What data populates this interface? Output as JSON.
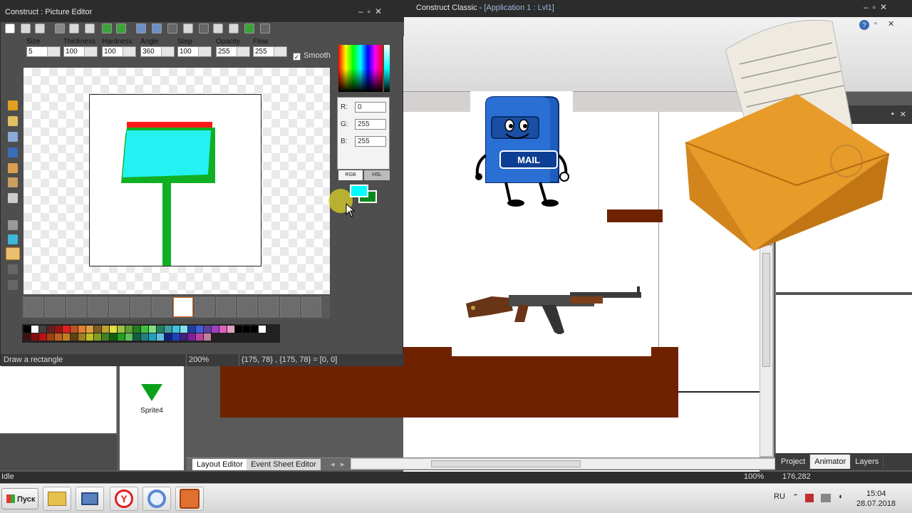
{
  "picture_editor": {
    "title": "Construct : Picture Editor",
    "params": [
      {
        "label": "Size",
        "value": "5"
      },
      {
        "label": "Thickness",
        "value": "100"
      },
      {
        "label": "Hardness",
        "value": "100"
      },
      {
        "label": "Angle",
        "value": "360"
      },
      {
        "label": "Step",
        "value": "100"
      },
      {
        "label": "Opacity",
        "value": "255"
      },
      {
        "label": "Flow",
        "value": "255"
      }
    ],
    "smooth_label": "Smooth",
    "smooth_checked": true,
    "rgb": {
      "r_label": "R:",
      "r": "0",
      "g_label": "G:",
      "g": "255",
      "b_label": "B:",
      "b": "255"
    },
    "color_tabs": [
      "RGB",
      "HSL"
    ],
    "primary_color": "#00ffff",
    "secondary_color": "#0a8a1a",
    "status": {
      "hint": "Draw a rectangle",
      "zoom": "200%",
      "coords": "{175, 78} , {175, 78} = [0, 0]"
    }
  },
  "main_window": {
    "title_prefix": "Construct Classic - ",
    "title_app": "[Application 1 : Lvl1]",
    "sprite_label": "Sprite4",
    "editor_tabs": [
      "Layout Editor",
      "Event Sheet Editor"
    ],
    "panel_tabs": [
      "Project",
      "Animator",
      "Layers"
    ],
    "mailbox_label": "MAIL",
    "status": {
      "left": "Idle",
      "zoom": "100%",
      "coords": "176,282"
    }
  },
  "taskbar": {
    "start_label": "Пуск",
    "lang": "RU",
    "time": "15:04",
    "date": "28.07.2018"
  }
}
